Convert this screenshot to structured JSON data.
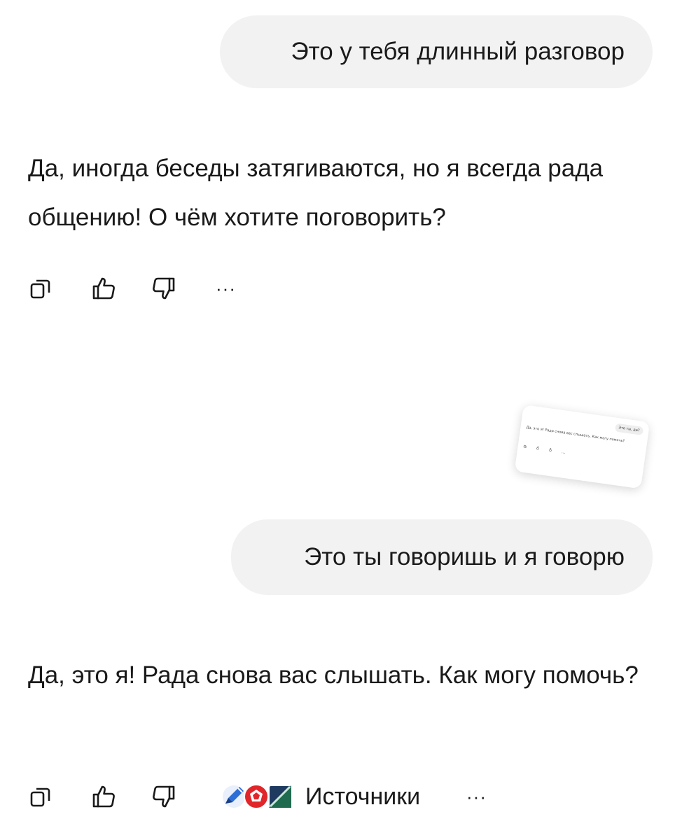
{
  "conversation": {
    "messages": [
      {
        "role": "user",
        "text": "Это у тебя длинный разговор"
      },
      {
        "role": "assistant",
        "text": "Да, иногда беседы затягиваются, но я всегда рада общению! О чём хотите поговорить?"
      },
      {
        "role": "user",
        "text": "Это ты говоришь и я говорю"
      },
      {
        "role": "assistant",
        "text": "Да, это я! Рада снова вас слышать. Как могу помочь?"
      }
    ]
  },
  "actions": {
    "more": "···",
    "sources_label": "Источники",
    "icons": [
      "copy-icon",
      "thumbs-up-icon",
      "thumbs-down-icon",
      "more-icon"
    ]
  },
  "preview_card": {
    "user_text": "Это ты, да?",
    "assistant_text": "Да, это я! Рада снова вас слышать. Как могу помочь?",
    "actions": "⧉ ♁ ♁ …"
  },
  "colors": {
    "bubble_bg": "#f2f2f2",
    "text": "#1a1a1a",
    "background": "#ffffff"
  }
}
